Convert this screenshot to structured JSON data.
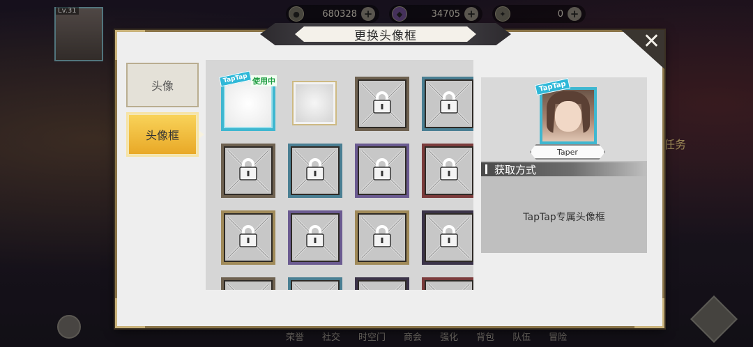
{
  "hud": {
    "player_level": "Lv.31",
    "resources": [
      {
        "icon": "gold-coin-icon",
        "value": "680328"
      },
      {
        "icon": "purple-gem-icon",
        "value": "34705"
      },
      {
        "icon": "token-icon",
        "value": "0"
      }
    ],
    "bottom_nav": [
      "荣誉",
      "社交",
      "时空门",
      "商会",
      "强化",
      "背包",
      "队伍",
      "冒险"
    ],
    "side_quest_label": "任务"
  },
  "dialog": {
    "title": "更换头像框",
    "close_icon": "close-icon",
    "tabs": [
      {
        "label": "头像",
        "selected": false
      },
      {
        "label": "头像框",
        "selected": true
      }
    ],
    "frames": [
      {
        "style": "current",
        "locked": false,
        "badge": "TapTap",
        "status": "使用中"
      },
      {
        "style": "plain",
        "locked": false
      },
      {
        "style": "bronze",
        "locked": true
      },
      {
        "style": "teal",
        "locked": true
      },
      {
        "style": "bronze",
        "locked": true
      },
      {
        "style": "teal",
        "locked": true
      },
      {
        "style": "purple",
        "locked": true
      },
      {
        "style": "red",
        "locked": true
      },
      {
        "style": "gold",
        "locked": true
      },
      {
        "style": "purple",
        "locked": true
      },
      {
        "style": "gold",
        "locked": true
      },
      {
        "style": "dark",
        "locked": true
      },
      {
        "style": "bronze",
        "locked": true
      },
      {
        "style": "teal",
        "locked": true
      },
      {
        "style": "dark",
        "locked": true
      },
      {
        "style": "red",
        "locked": true
      }
    ],
    "preview": {
      "badge": "TapTap",
      "name": "Taper",
      "acquire_title": "获取方式",
      "acquire_text": "TapTap专属头像框"
    }
  }
}
